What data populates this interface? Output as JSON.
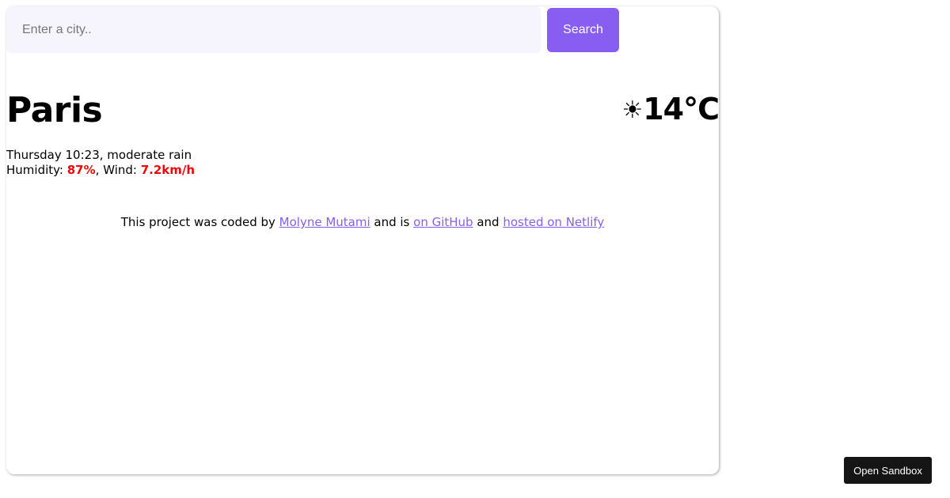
{
  "search": {
    "placeholder": "Enter a city..",
    "value": "",
    "button_label": "Search"
  },
  "weather": {
    "city": "Paris",
    "icon": "sun-icon",
    "icon_glyph": "☀",
    "temperature": "14",
    "unit": "°C",
    "day_time": "Thursday 10:23",
    "description": "moderate rain",
    "humidity_label": "Humidity: ",
    "humidity_value": "87%",
    "wind_label": "Wind: ",
    "wind_value": "7.2km/h"
  },
  "footer": {
    "text_before_author": "This project was coded by ",
    "author_link": "Molyne Mutami",
    "text_middle": " and is ",
    "github_link": "on GitHub",
    "text_and": " and ",
    "netlify_link": "hosted on Netlify"
  },
  "sandbox": {
    "button_label": "Open Sandbox"
  },
  "colors": {
    "accent": "#885df1",
    "highlight": "#f00707",
    "input_background": "#f6f5fd",
    "sandbox_button": "#151515"
  }
}
